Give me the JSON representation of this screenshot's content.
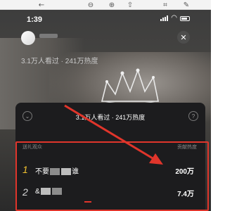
{
  "viewer": {
    "icons": [
      "back-icon",
      "forward-icon",
      "zoom-out-icon",
      "zoom-in-icon",
      "share-icon",
      "crop-icon",
      "edit-icon"
    ]
  },
  "status_bar": {
    "time": "1:39",
    "battery_percent": "",
    "icons": [
      "signal-icon",
      "wifi-icon",
      "battery-icon"
    ]
  },
  "live": {
    "top_stats": "3.1万人看过 · 241万热度",
    "close_label": "✕"
  },
  "panel": {
    "title": "3.1万人看过 · 241万热度",
    "col_left": "送礼观众",
    "col_right": "贡献热度",
    "rows": [
      {
        "rank": "1",
        "name_prefix": "不要",
        "name_suffix": "谁",
        "value": "200万"
      },
      {
        "rank": "2",
        "name_prefix": "&",
        "name_suffix": "",
        "value": "7.4万"
      }
    ]
  },
  "annotation": {
    "color": "#e0352b"
  }
}
